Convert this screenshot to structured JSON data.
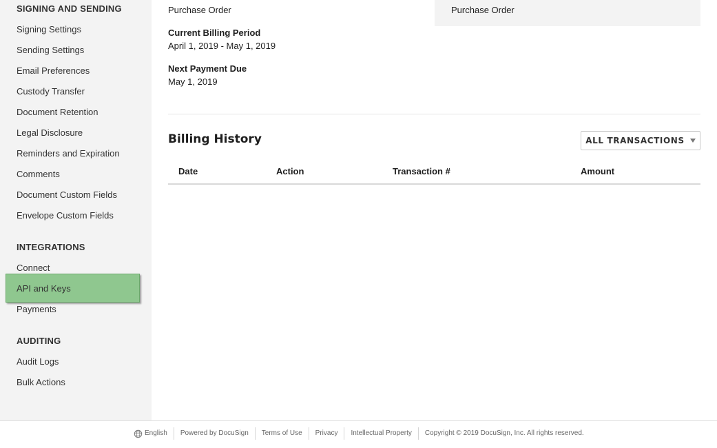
{
  "sidebar": {
    "sections": [
      {
        "heading": "SIGNING AND SENDING",
        "items": [
          "Signing Settings",
          "Sending Settings",
          "Email Preferences",
          "Custody Transfer",
          "Document Retention",
          "Legal Disclosure",
          "Reminders and Expiration",
          "Comments",
          "Document Custom Fields",
          "Envelope Custom Fields"
        ]
      },
      {
        "heading": "INTEGRATIONS",
        "items": [
          "Connect",
          "API and Keys",
          "Payments"
        ]
      },
      {
        "heading": "AUDITING",
        "items": [
          "Audit Logs",
          "Bulk Actions"
        ]
      }
    ],
    "active_item": "API and Keys"
  },
  "billing": {
    "payment_method_left": "Purchase Order",
    "payment_method_right": "Purchase Order",
    "current_period_label": "Current Billing Period",
    "current_period_value": "April 1, 2019 - May 1, 2019",
    "next_payment_label": "Next Payment Due",
    "next_payment_value": "May 1, 2019"
  },
  "history": {
    "title": "Billing History",
    "filter_label": "ALL TRANSACTIONS",
    "columns": [
      "Date",
      "Action",
      "Transaction #",
      "Amount"
    ]
  },
  "footer": {
    "language": "English",
    "powered_by": "Powered by DocuSign",
    "terms": "Terms of Use",
    "privacy": "Privacy",
    "ip": "Intellectual Property",
    "copyright": "Copyright © 2019 DocuSign, Inc. All rights reserved."
  }
}
